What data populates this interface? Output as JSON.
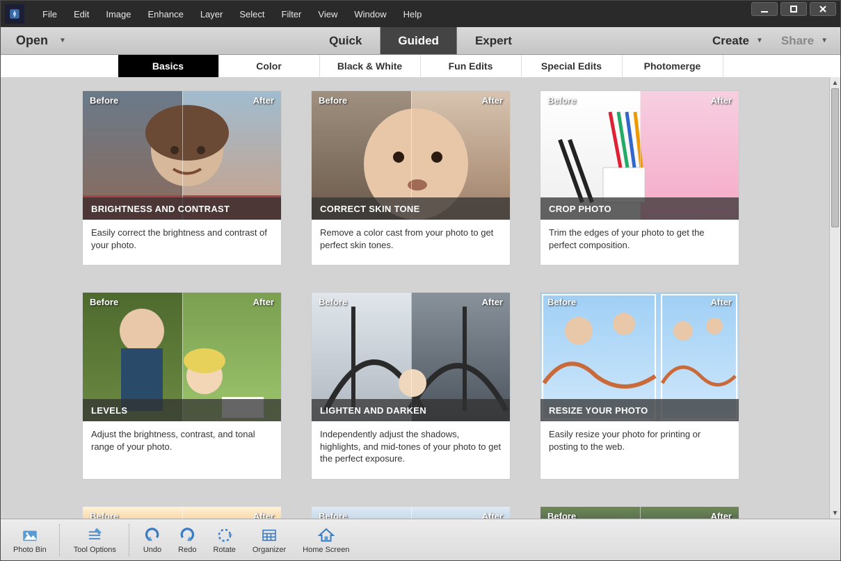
{
  "menu": {
    "items": [
      "File",
      "Edit",
      "Image",
      "Enhance",
      "Layer",
      "Select",
      "Filter",
      "View",
      "Window",
      "Help"
    ]
  },
  "modebar": {
    "open": "Open",
    "tabs": [
      "Quick",
      "Guided",
      "Expert"
    ],
    "active": "Guided",
    "create": "Create",
    "share": "Share"
  },
  "subtabs": {
    "items": [
      "Basics",
      "Color",
      "Black & White",
      "Fun Edits",
      "Special Edits",
      "Photomerge"
    ],
    "active": "Basics"
  },
  "labels": {
    "before": "Before",
    "after": "After"
  },
  "cards": [
    {
      "title": "BRIGHTNESS AND CONTRAST",
      "desc": "Easily correct the brightness and contrast of your photo."
    },
    {
      "title": "CORRECT SKIN TONE",
      "desc": "Remove a color cast from your photo to get perfect skin tones."
    },
    {
      "title": "CROP PHOTO",
      "desc": "Trim the edges of your photo to get the perfect composition."
    },
    {
      "title": "LEVELS",
      "desc": "Adjust the brightness, contrast, and tonal range of your photo."
    },
    {
      "title": "LIGHTEN AND DARKEN",
      "desc": "Independently adjust the shadows, highlights, and mid-tones of your photo to get the perfect exposure."
    },
    {
      "title": "RESIZE YOUR PHOTO",
      "desc": "Easily resize your photo for printing or posting to the web."
    }
  ],
  "bottombar": {
    "items": [
      "Photo Bin",
      "Tool Options",
      "Undo",
      "Redo",
      "Rotate",
      "Organizer",
      "Home Screen"
    ]
  }
}
